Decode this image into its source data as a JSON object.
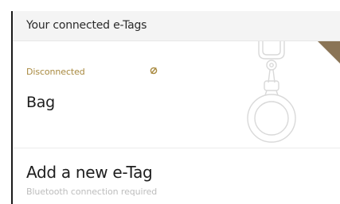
{
  "header": {
    "title": "Your connected e-Tags"
  },
  "connected_tags": [
    {
      "status": "Disconnected",
      "status_icon": "disconnected-icon",
      "name": "Bag",
      "illustration": "etag-keyring-icon"
    }
  ],
  "add_tag": {
    "title": "Add a new e-Tag",
    "subtitle": "Bluetooth connection required"
  },
  "colors": {
    "status_gold": "#a8893f",
    "corner_flag": "#8a7456",
    "header_bg": "#f4f4f4",
    "subtitle_gray": "#bdbdbd"
  }
}
